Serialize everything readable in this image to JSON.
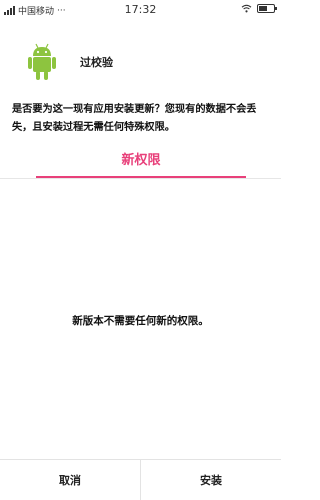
{
  "status_bar": {
    "carrier": "中国移动",
    "dots": "···",
    "time": "17:32"
  },
  "app": {
    "name": "过校验",
    "icon": "android-icon",
    "icon_color": "#8dc43f"
  },
  "prompt": {
    "text": "是否要为这一现有应用安装更新？您现有的数据不会丢失，且安装过程无需任何特殊权限。"
  },
  "tabs": [
    {
      "label": "新权限",
      "active": true,
      "color": "#e8407a"
    }
  ],
  "permissions": {
    "message": "新版本不需要任何新的权限。"
  },
  "buttons": {
    "cancel_label": "取消",
    "install_label": "安装"
  }
}
